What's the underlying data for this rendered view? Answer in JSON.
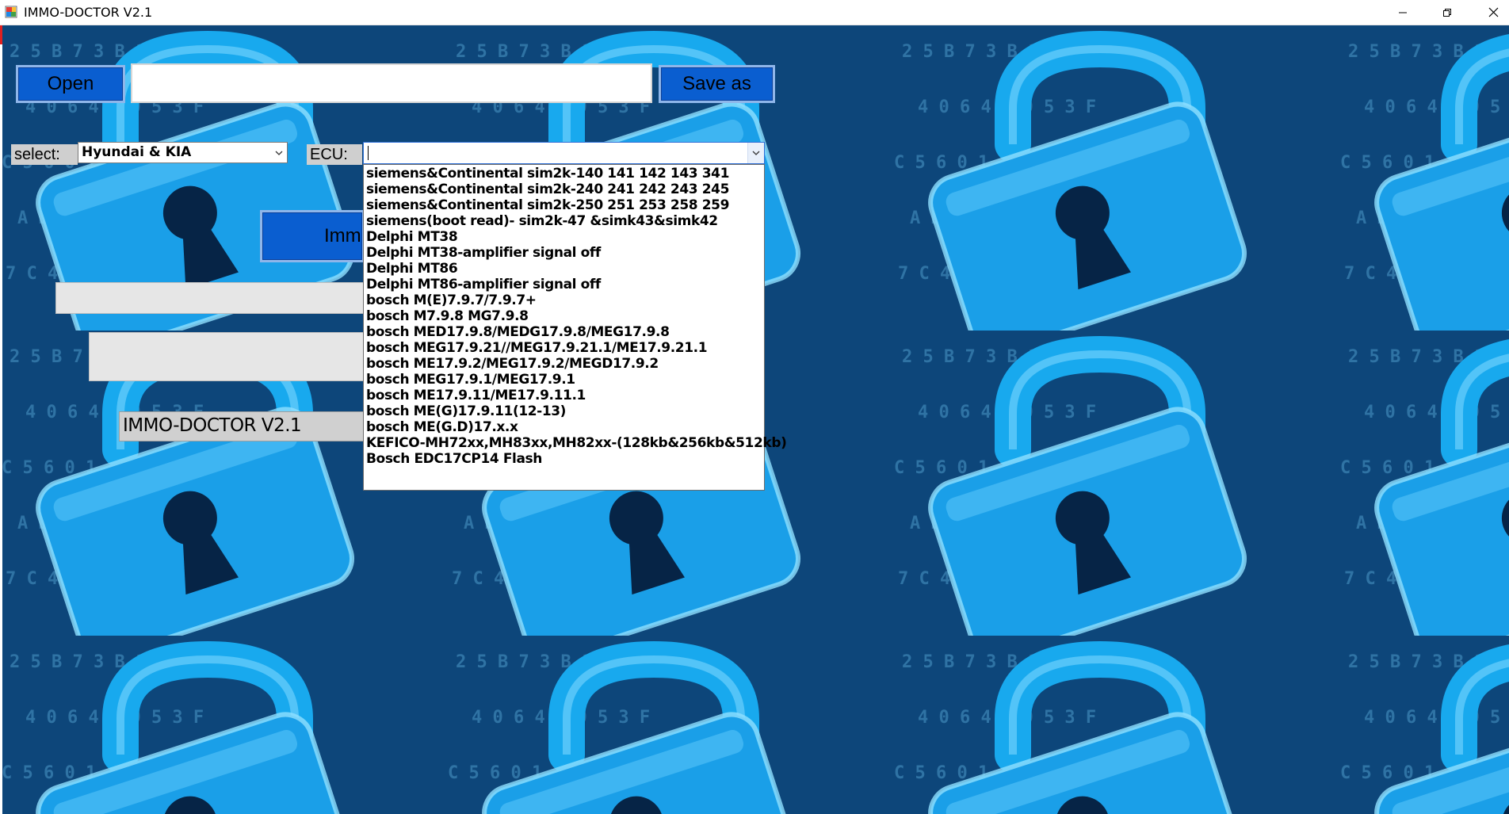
{
  "window": {
    "title": "IMMO-DOCTOR V2.1",
    "controls": {
      "minimize_icon": "minimize-icon",
      "restore_icon": "restore-icon",
      "close_icon": "close-icon"
    }
  },
  "toolbar": {
    "open_label": "Open",
    "file_path_value": "",
    "save_as_label": "Save as"
  },
  "selectors": {
    "select_label": "select:",
    "brand_value": "Hyundai & KIA",
    "ecu_label": "ECU:",
    "ecu_value": ""
  },
  "ecu_options": [
    "siemens&Continental sim2k-140 141 142 143 341",
    "siemens&Continental sim2k-240 241 242 243 245",
    "siemens&Continental sim2k-250 251 253 258 259",
    "siemens(boot read)- sim2k-47 &simk43&simk42",
    "Delphi MT38",
    "Delphi MT38-amplifier signal off",
    "Delphi MT86",
    "Delphi MT86-amplifier signal off",
    "bosch M(E)7.9.7/7.9.7+",
    "bosch M7.9.8 MG7.9.8",
    "bosch MED17.9.8/MEDG17.9.8/MEG17.9.8",
    "bosch MEG17.9.21//MEG17.9.21.1/ME17.9.21.1",
    "bosch ME17.9.2/MEG17.9.2/MEGD17.9.2",
    "bosch MEG17.9.1/MEG17.9.1",
    "bosch ME17.9.11/ME17.9.11.1",
    "bosch ME(G)17.9.11(12-13)",
    "bosch ME(G.D)17.x.x",
    "KEFICO-MH72xx,MH83xx,MH82xx-(128kb&256kb&512kb)",
    "Bosch EDC17CP14 Flash"
  ],
  "main": {
    "immo_button_label": "Imm",
    "version_text": "IMMO-DOCTOR V2.1"
  },
  "colors": {
    "button_blue": "#0a5ed0",
    "label_gray": "#cfcfcf",
    "background_cyan": "#1ea0e6"
  }
}
